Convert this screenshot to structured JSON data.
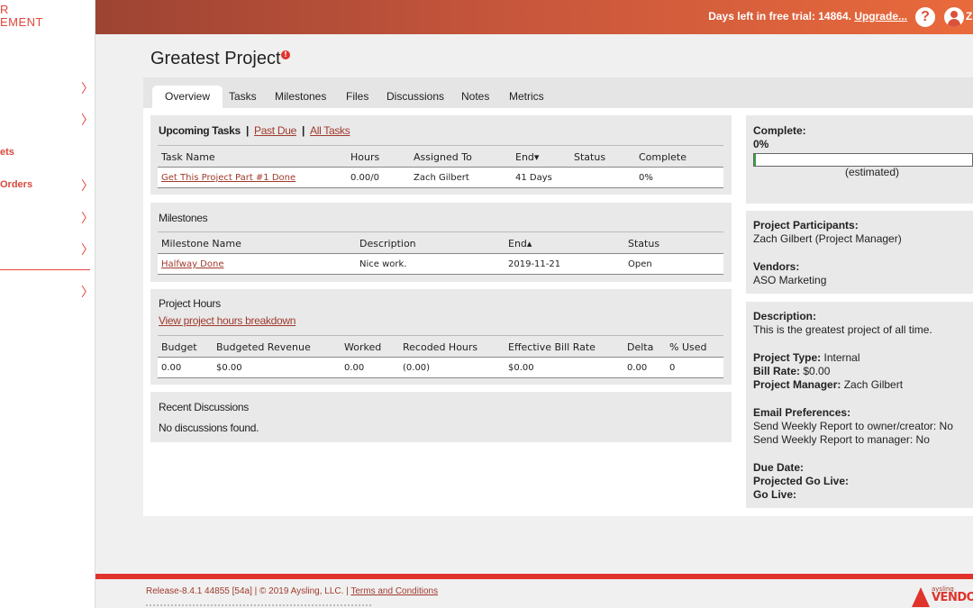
{
  "sidebar": {
    "logo_line1": "R",
    "logo_line2": "EMENT",
    "items": [
      {
        "label": "",
        "chevron": "〉"
      },
      {
        "label": "",
        "chevron": "〉"
      },
      {
        "label": "ets",
        "chevron": ""
      },
      {
        "label": "Orders",
        "chevron": "〉"
      },
      {
        "label": "",
        "chevron": "〉"
      },
      {
        "label": "",
        "chevron": "〉"
      },
      {
        "label": "",
        "chevron": "〉"
      }
    ]
  },
  "topbar": {
    "trial_text": "Days left in free trial: 14864.",
    "upgrade_link": "Upgrade...",
    "help_icon": "?",
    "user_initial": "Z"
  },
  "page": {
    "title": "Greatest Project",
    "alert_badge": "!"
  },
  "tabs": [
    {
      "label": "Overview",
      "active": true
    },
    {
      "label": "Tasks"
    },
    {
      "label": "Milestones"
    },
    {
      "label": "Files"
    },
    {
      "label": "Discussions"
    },
    {
      "label": "Notes"
    },
    {
      "label": "Metrics"
    }
  ],
  "upcoming_tasks": {
    "title": "Upcoming Tasks",
    "sep": "|",
    "past_due_link": "Past Due",
    "all_tasks_link": "All Tasks",
    "headers": [
      "Task Name",
      "Hours",
      "Assigned To",
      "End▾",
      "Status",
      "Complete"
    ],
    "rows": [
      {
        "task_name": "Get This Project Part #1 Done",
        "hours": "0.00/0",
        "assigned_to": "Zach Gilbert",
        "end": "41 Days",
        "status": "",
        "complete": "0%"
      }
    ]
  },
  "milestones": {
    "title": "Milestones",
    "headers": [
      "Milestone Name",
      "Description",
      "End▴",
      "Status"
    ],
    "rows": [
      {
        "name": "Halfway Done",
        "description": "Nice work.",
        "end": "2019-11-21",
        "status": "Open"
      }
    ]
  },
  "project_hours": {
    "title": "Project Hours",
    "breakdown_link": "View project hours breakdown",
    "headers": [
      "Budget",
      "Budgeted Revenue",
      "Worked",
      "Recoded Hours",
      "Effective Bill Rate",
      "Delta",
      "% Used"
    ],
    "rows": [
      {
        "budget": "0.00",
        "budgeted_revenue": "$0.00",
        "worked": "0.00",
        "recoded_hours": "(0.00)",
        "effective_bill_rate": "$0.00",
        "delta": "0.00",
        "pct_used": "0"
      }
    ]
  },
  "recent_discussions": {
    "title": "Recent Discussions",
    "empty_text": "No discussions found."
  },
  "progress": {
    "label": "Complete:",
    "value_text": "0%",
    "value": 0,
    "estimated": "(estimated)",
    "bar_color": "#3aa043"
  },
  "participants": {
    "label": "Project Participants:",
    "value": "Zach Gilbert (Project Manager)",
    "vendors_label": "Vendors:",
    "vendors_value": "ASO Marketing"
  },
  "details": {
    "description_label": "Description:",
    "description_value": "This is the greatest project of all time.",
    "project_type_label": "Project Type:",
    "project_type_value": "Internal",
    "bill_rate_label": "Bill Rate:",
    "bill_rate_value": "$0.00",
    "pm_label": "Project Manager:",
    "pm_value": "Zach Gilbert",
    "email_prefs_label": "Email Preferences:",
    "email_pref_owner": "Send Weekly Report to owner/creator: No",
    "email_pref_manager": "Send Weekly Report to manager: No",
    "due_date_label": "Due Date:",
    "projected_go_live_label": "Projected Go Live:",
    "go_live_label": "Go Live:"
  },
  "footer": {
    "release_text": "Release-8.4.1 44855 [54a] | © 2019 Aysling, LLC. |",
    "terms_link": "Terms and Conditions",
    "logo_small": "aysling",
    "logo_big": "VENDOR"
  }
}
